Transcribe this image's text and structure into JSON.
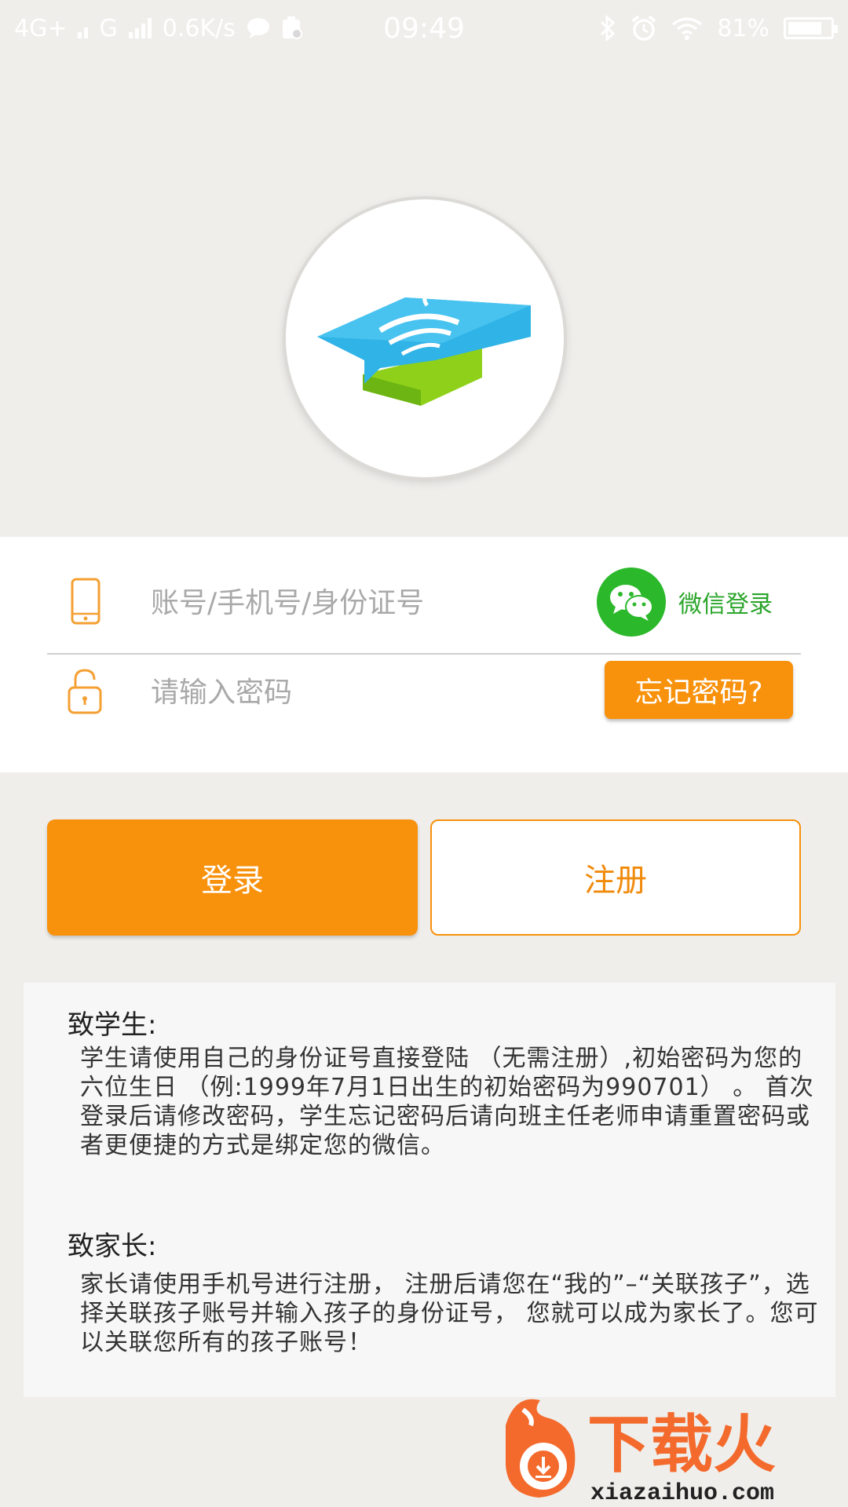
{
  "status_bar": {
    "network1": "4G+",
    "network2": "G",
    "speed": "0.6K/s",
    "time": "09:49",
    "battery": "81%",
    "battery_level": 0.81
  },
  "login": {
    "account_placeholder": "账号/手机号/身份证号",
    "password_placeholder": "请输入密码",
    "wechat_label": "微信登录",
    "forgot_label": "忘记密码?"
  },
  "actions": {
    "login_label": "登录",
    "register_label": "注册"
  },
  "notice": {
    "student_title": "致学生:",
    "student_text": "学生请使用自己的身份证号直接登陆 （无需注册）,初始密码为您的六位生日 （例:1999年7月1日出生的初始密码为990701） 。 首次登录后请修改密码，学生忘记密码后请向班主任老师申请重置密码或者更便捷的方式是绑定您的微信。",
    "parent_title": "致家长:",
    "parent_text": "家长请使用手机号进行注册， 注册后请您在“我的”–“关联孩子”，选择关联孩子账号并输入孩子的身份证号， 您就可以成为家长了。您可以关联您所有的孩子账号！"
  },
  "watermark": {
    "brand": "下载火",
    "url": "xiazaihuo.com"
  },
  "colors": {
    "accent": "#f8910c",
    "wechat": "#2bb82b",
    "background": "#efeeeb"
  },
  "icons": {
    "phone": "phone-icon",
    "lock": "lock-icon",
    "wechat": "wechat-icon",
    "logo": "graduation-cap-logo"
  }
}
